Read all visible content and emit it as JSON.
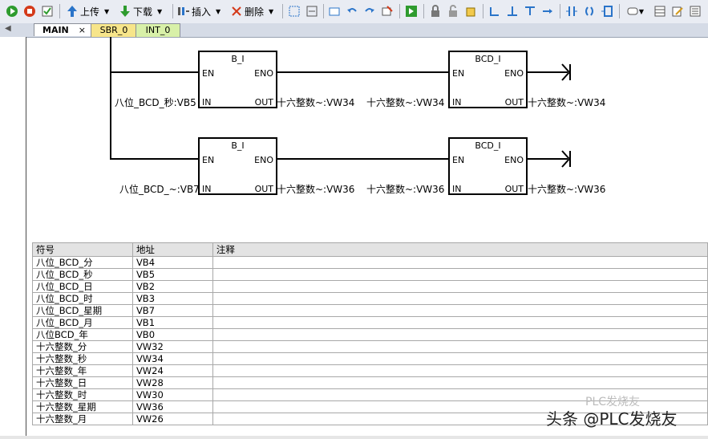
{
  "toolbar": {
    "upload_label": "上传",
    "download_label": "下载",
    "insert_label": "插入",
    "delete_label": "删除"
  },
  "tabs": [
    {
      "label": "MAIN",
      "active": true
    },
    {
      "label": "SBR_0",
      "active": false
    },
    {
      "label": "INT_0",
      "active": false
    }
  ],
  "close_glyph": "×",
  "network": {
    "rung1": {
      "fb1_title": "B_I",
      "fb1_en": "EN",
      "fb1_eno": "ENO",
      "fb1_in": "IN",
      "fb1_out": "OUT",
      "fb1_in_label": "八位_BCD_秒:VB5",
      "fb1_out_label": "十六整数~:VW34",
      "fb2_title": "BCD_I",
      "fb2_en": "EN",
      "fb2_eno": "ENO",
      "fb2_in": "IN",
      "fb2_out": "OUT",
      "fb2_in_label": "十六整数~:VW34",
      "fb2_out_label": "十六整数~:VW34"
    },
    "rung2": {
      "fb1_title": "B_I",
      "fb1_en": "EN",
      "fb1_eno": "ENO",
      "fb1_in": "IN",
      "fb1_out": "OUT",
      "fb1_in_label": "八位_BCD_~:VB7",
      "fb1_out_label": "十六整数~:VW36",
      "fb2_title": "BCD_I",
      "fb2_en": "EN",
      "fb2_eno": "ENO",
      "fb2_in": "IN",
      "fb2_out": "OUT",
      "fb2_in_label": "十六整数~:VW36",
      "fb2_out_label": "十六整数~:VW36"
    }
  },
  "symbol_table": {
    "headers": [
      "符号",
      "地址",
      "注释"
    ],
    "rows": [
      [
        "八位_BCD_分",
        "VB4",
        ""
      ],
      [
        "八位_BCD_秒",
        "VB5",
        ""
      ],
      [
        "八位_BCD_日",
        "VB2",
        ""
      ],
      [
        "八位_BCD_时",
        "VB3",
        ""
      ],
      [
        "八位_BCD_星期",
        "VB7",
        ""
      ],
      [
        "八位_BCD_月",
        "VB1",
        ""
      ],
      [
        "八位BCD_年",
        "VB0",
        ""
      ],
      [
        "十六整数_分",
        "VW32",
        ""
      ],
      [
        "十六整数_秒",
        "VW34",
        ""
      ],
      [
        "十六整数_年",
        "VW24",
        ""
      ],
      [
        "十六整数_日",
        "VW28",
        ""
      ],
      [
        "十六整数_时",
        "VW30",
        ""
      ],
      [
        "十六整数_星期",
        "VW36",
        ""
      ],
      [
        "十六整数_月",
        "VW26",
        ""
      ]
    ]
  },
  "watermark": "头条 @PLC发烧友",
  "watermark_faint": "PLC发烧友",
  "colors": {
    "toolbar_bg": "#e9ecf3",
    "tab_active": "#ffffff",
    "tab_sbr": "#f7e58a",
    "tab_int": "#d8f0a8",
    "play_green": "#2e9b2e",
    "stop_red": "#d43a1a"
  }
}
